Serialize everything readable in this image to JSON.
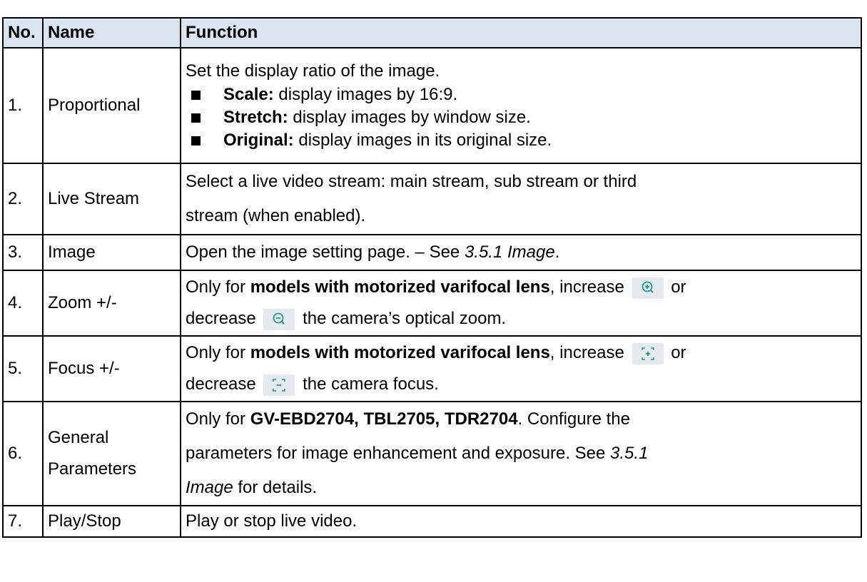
{
  "header": {
    "no": "No.",
    "name": "Name",
    "function": "Function"
  },
  "rows": [
    {
      "no": "1.",
      "name": "Proportional",
      "intro": "Set the display ratio of the image.",
      "bullets": [
        {
          "term": "Scale:",
          "desc": " display images by 16:9."
        },
        {
          "term": "Stretch:",
          "desc": " display images by window size."
        },
        {
          "term": "Original:",
          "desc": " display images in its original size."
        }
      ]
    },
    {
      "no": "2.",
      "name": "Live Stream",
      "line1": "Select a live video stream: main stream, sub stream or third",
      "line2": "stream (when enabled)."
    },
    {
      "no": "3.",
      "name": "Image",
      "text": "Open the image setting page.  – See ",
      "ref": "3.5.1 Image",
      "end": "."
    },
    {
      "no": "4.",
      "name": "Zoom +/-",
      "pre": "Only for ",
      "bold": "models with motorized varifocal lens",
      "mid": ", increase",
      "icon_increase": "zoom-in-icon",
      "or": "or",
      "decrease": "decrease",
      "icon_decrease": "zoom-out-icon",
      "post": "the camera’s optical zoom."
    },
    {
      "no": "5.",
      "name": "Focus +/-",
      "pre": "Only for ",
      "bold": "models with motorized varifocal lens",
      "mid": ", increase",
      "icon_increase": "focus-in-icon",
      "or": "or",
      "decrease": "decrease",
      "icon_decrease": "focus-out-icon",
      "post": "the camera focus."
    },
    {
      "no": "6.",
      "name_line1": "General",
      "name_line2": "Parameters",
      "pre": "Only for ",
      "bold": "GV-EBD2704, TBL2705, TDR2704",
      "line1_end": ". Configure the",
      "line2": "parameters for image enhancement and exposure. See ",
      "ref1": "3.5.1",
      "ref2": "Image",
      "line3_end": " for details."
    },
    {
      "no": "7.",
      "name": "Play/Stop",
      "text": "Play or stop live video."
    }
  ]
}
